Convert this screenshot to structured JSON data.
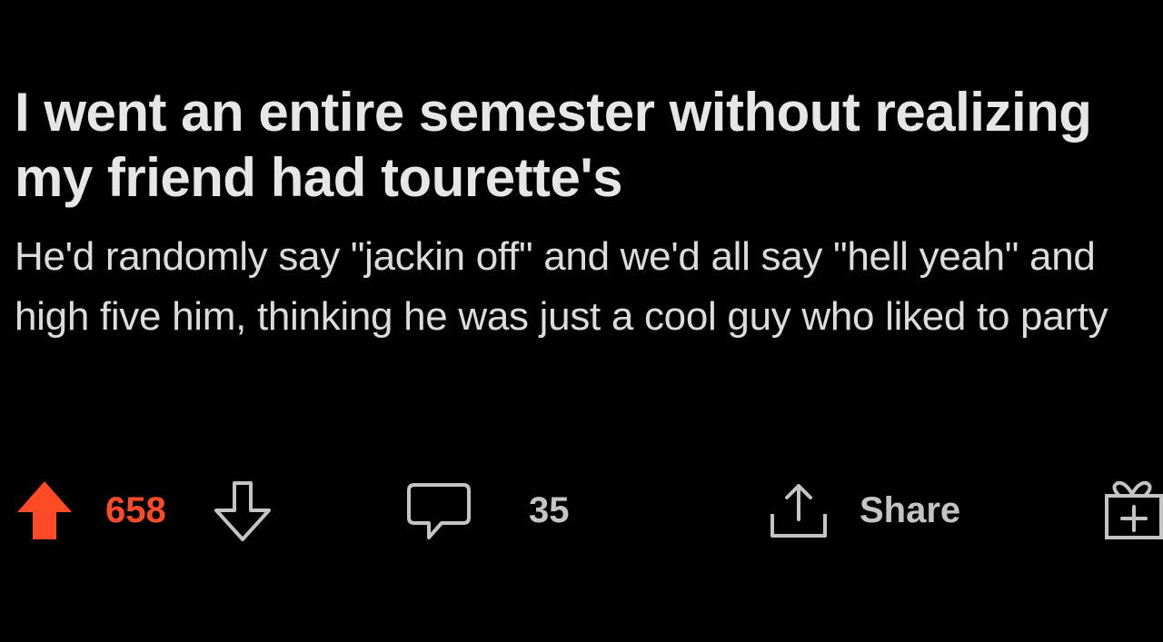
{
  "post": {
    "title": "I went an entire semester without realizing my friend had tourette's",
    "body": "He'd randomly say \"jackin off\" and we'd all say \"hell yeah\" and high five him, thinking he was just a cool guy who liked to party"
  },
  "actions": {
    "upvote_icon": "upvote-arrow-icon",
    "vote_count": "658",
    "downvote_icon": "downvote-arrow-icon",
    "comment_icon": "speech-bubble-icon",
    "comment_count": "35",
    "share_icon": "share-upload-icon",
    "share_label": "Share",
    "award_icon": "gift-award-icon"
  },
  "colors": {
    "background": "#000000",
    "upvote_active": "#ff4a27",
    "text": "#e6e6e6",
    "muted": "#c4c4c4"
  }
}
